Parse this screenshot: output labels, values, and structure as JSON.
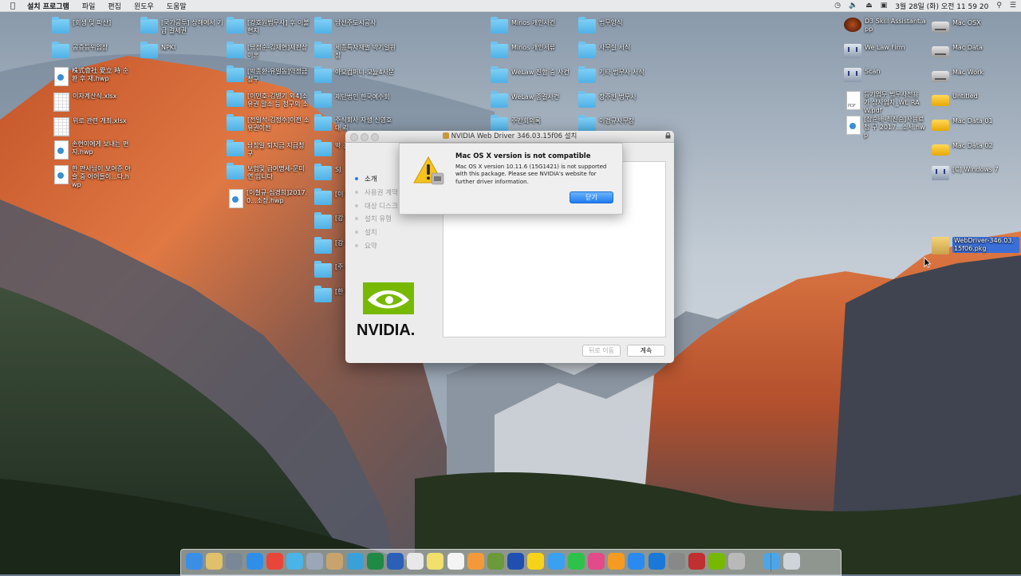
{
  "menubar": {
    "app_name": "설치 프로그램",
    "menus": [
      "파일",
      "편집",
      "윈도우",
      "도움말"
    ],
    "clock": "3월 28일 (화) 오전  11 59 20"
  },
  "desktop": {
    "col1": [
      "[회생 및 파산]",
      "공증등위임장",
      "株式會社 愛立 時 순환 후 재.hwp",
      "이자계산식.xlsx",
      "위로 관련 개최.xlsx",
      "손현이에게 보내는 편지.hwp",
      "한 판사님이 보여준 아슬 중 어어들이...다.hwp"
    ],
    "col2": [
      "[국가공투] 상해에서 기 급 결세권",
      "NPKI"
    ],
    "col3": [
      "[강호원법무사] 후 이불 현지",
      "[남정순-김재현]재판상 이혼",
      "[박종환-유일동]약정금 청구",
      "[이민호-김병기 외4]소 유권 말소 등 청구의 소",
      "[전일석-김정수]이전 소 유권이전",
      "남창일 퇴지금 지급청구",
      "보험및 급여명세-문미연 입니다",
      "[이철규-심경희]2017.0...소장.hwp"
    ],
    "col4": [
      "남선주도시공사",
      "세종특자재벌 박기일원 장",
      "아모컴퍼니-모듈4사문",
      "재단법인 한국예수회",
      "주식회사 자생 신영호대 리",
      "박 종",
      "SJ",
      "[이 해",
      "[강 수",
      "[강 증",
      "[주 선]",
      "[한 취"
    ],
    "col5": [
      "Minos 개인사건",
      "Minos 개인서류",
      "WeLaw 진행 중 사건",
      "WeLaw 종결사건",
      "주간회의록"
    ],
    "col6": [
      "법무양식",
      "사무실 서식",
      "기타 법무사 서식",
      "장주한 법무사",
      "이경규사무장"
    ],
    "col7": [
      "D3 Skill Assistant.app",
      "We Law Firm",
      "Scan",
      "등기업무 법무사전용 가 상사업자_WE RAW.pdf",
      "[장순배-최진순]사용료청 구 2017...소서.hwp"
    ],
    "col8": [
      "Mac OSX",
      "Mac Data",
      "Mac Work",
      "Untitled",
      "Mac Data 01",
      "Mac Data 02",
      "[C] Windows 7"
    ],
    "package": "WebDriver-346.03.15f06.pkg"
  },
  "installer": {
    "title": "NVIDIA Web Driver 346.03.15f06 설치",
    "steps": [
      "소개",
      "사용권 계약",
      "대상 디스크",
      "설치 유형",
      "설치",
      "요약"
    ],
    "active_step": 0,
    "logo_text": "NVIDIA.",
    "back_label": "뒤로 이동",
    "continue_label": "계속"
  },
  "alert": {
    "title": "Mac OS X version is not compatible",
    "message": "Mac OS X version 10.11.6 (15G1421) is not supported with this package. Please see NVIDIA's website for further driver information.",
    "button": "닫기"
  },
  "dock": {
    "items": [
      "finder-icon",
      "folder-icon",
      "launchpad-icon",
      "safari-icon",
      "chrome-icon",
      "network-icon",
      "preview-icon",
      "notes-icon",
      "hwp-icon",
      "excel-icon",
      "word-icon",
      "calendar-icon",
      "stickies-icon",
      "textedit-icon",
      "photos-icon",
      "messages-icon",
      "keynote-icon",
      "kakaotalk-icon",
      "messenger-icon",
      "facetime-icon",
      "itunes-icon",
      "ibooks-icon",
      "appstore-icon",
      "teamviewer-icon",
      "sysprefs-icon",
      "monitor-icon",
      "nvidia-icon",
      "installer-icon",
      "downloads-icon",
      "trash-icon"
    ]
  },
  "colors": {
    "accent": "#1e7cf0",
    "nvidia_green": "#76b900"
  }
}
